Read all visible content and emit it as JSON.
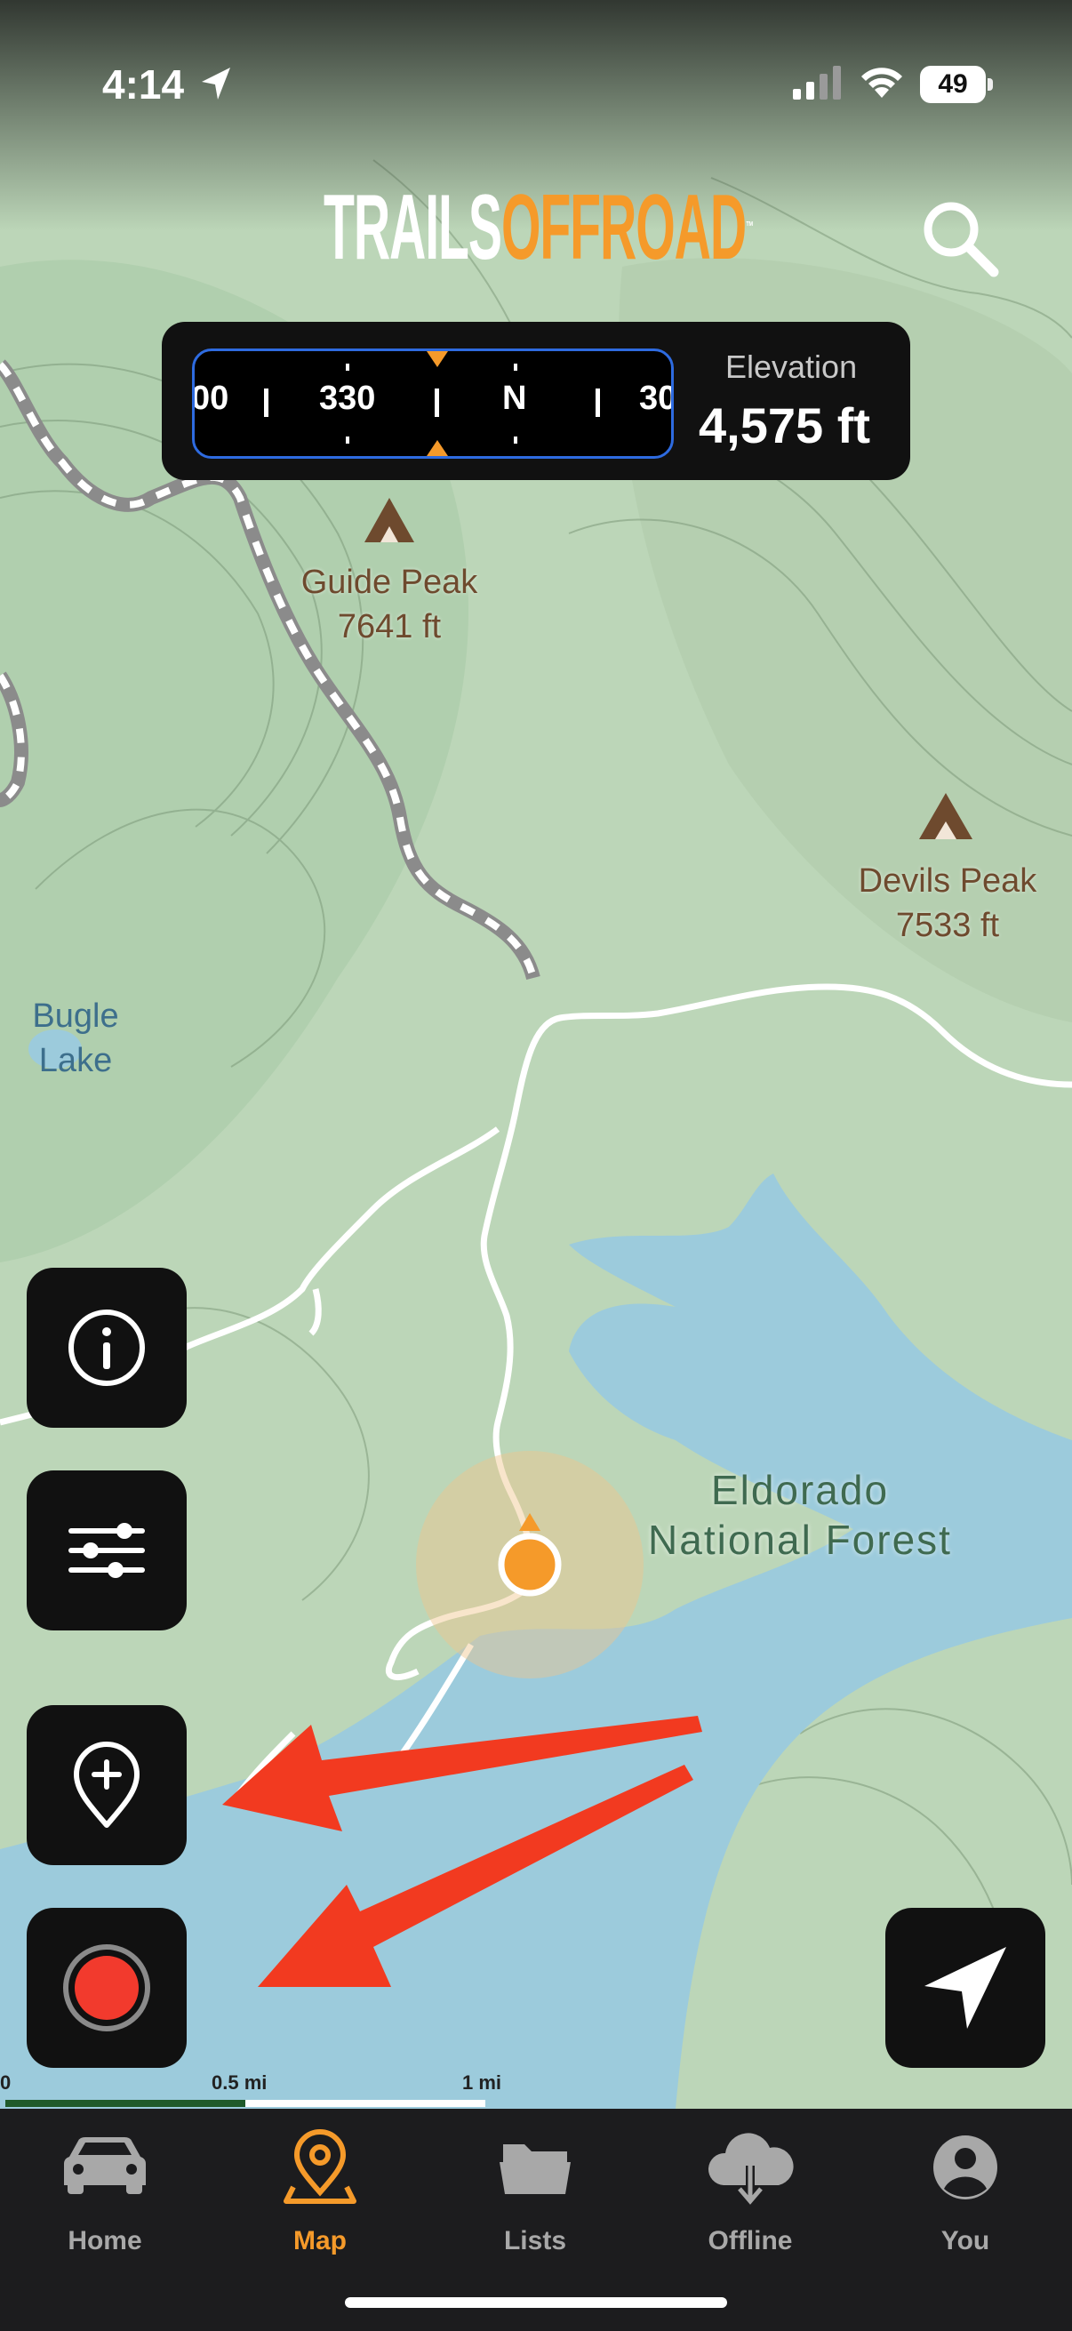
{
  "status_bar": {
    "time": "4:14",
    "battery": "49"
  },
  "header": {
    "logo_part1": "TRAILS",
    "logo_part2": "OFFROAD",
    "trademark": "™"
  },
  "compass": {
    "labels": [
      "00",
      "330",
      "N",
      "30"
    ]
  },
  "elevation": {
    "label": "Elevation",
    "value": "4,575 ft"
  },
  "map_labels": {
    "guide_peak": {
      "name": "Guide Peak",
      "elev": "7641 ft"
    },
    "devils_peak": {
      "name": "Devils Peak",
      "elev": "7533 ft"
    },
    "bugle_lake": {
      "line1": "Bugle",
      "line2": "Lake"
    },
    "forest": {
      "line1": "Eldorado",
      "line2": "National Forest"
    }
  },
  "scale": {
    "labels": [
      "0",
      "0.5 mi",
      "1 mi"
    ]
  },
  "tabs": [
    {
      "label": "Home",
      "icon": "car-icon",
      "active": false
    },
    {
      "label": "Map",
      "icon": "map-pin-icon",
      "active": true
    },
    {
      "label": "Lists",
      "icon": "folder-icon",
      "active": false
    },
    {
      "label": "Offline",
      "icon": "cloud-download-icon",
      "active": false
    },
    {
      "label": "You",
      "icon": "person-icon",
      "active": false
    }
  ],
  "colors": {
    "accent": "#f59a2a",
    "record": "#f23a2d",
    "annotation_arrow": "#f23a20",
    "water": "#9ccbdc",
    "land": "#bcd6b8"
  }
}
